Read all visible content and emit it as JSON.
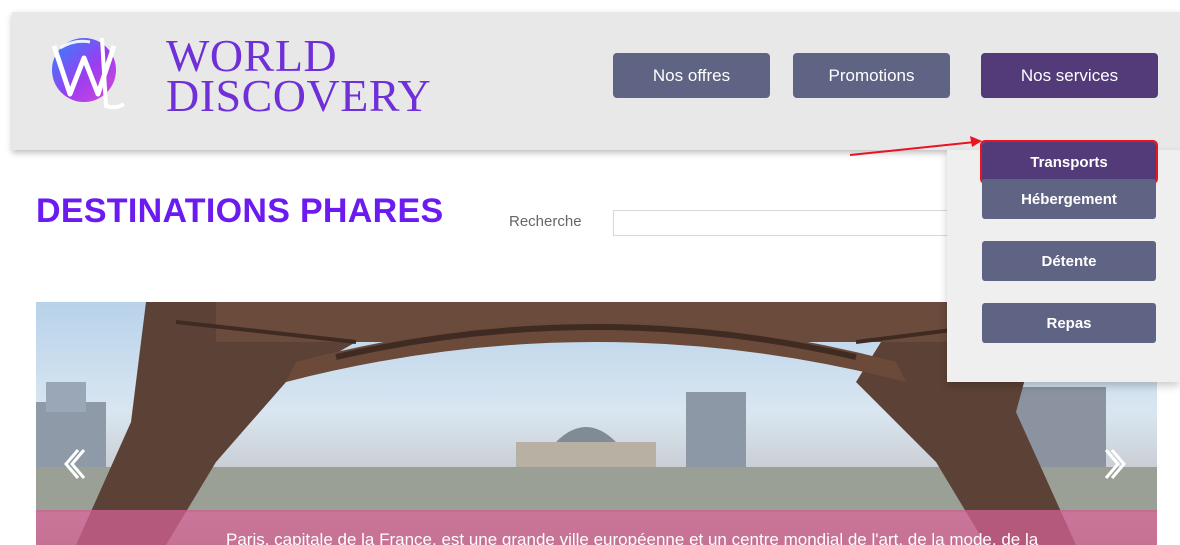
{
  "logo": {
    "line1": "WORLD",
    "line2": "DISCOVERY"
  },
  "nav": {
    "offres": "Nos offres",
    "promotions": "Promotions",
    "services": "Nos services"
  },
  "dropdown": [
    {
      "label": "Transports",
      "active": true
    },
    {
      "label": "Hébergement"
    },
    {
      "label": "Détente"
    },
    {
      "label": "Repas"
    }
  ],
  "main": {
    "title": "DESTINATIONS PHARES",
    "search_label": "Recherche",
    "search_value": "",
    "caption": "Paris, capitale de la France, est une grande ville européenne et un centre mondial de l'art, de la mode, de la"
  },
  "colors": {
    "accent": "#6b1bf0",
    "nav_button": "#5f6384",
    "nav_active": "#533b7a",
    "highlight": "#e8141f"
  }
}
